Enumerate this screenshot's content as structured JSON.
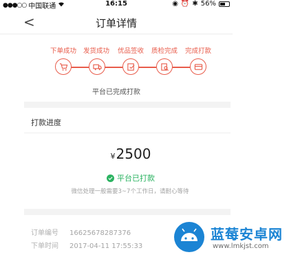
{
  "status_bar": {
    "carrier": "中国联通",
    "time": "16:15",
    "battery": "56%"
  },
  "nav": {
    "title": "订单详情",
    "back": "<"
  },
  "steps": [
    {
      "label": "下单成功",
      "icon": "cart-icon"
    },
    {
      "label": "发货成功",
      "icon": "truck-icon"
    },
    {
      "label": "优品签收",
      "icon": "sign-icon"
    },
    {
      "label": "质检完成",
      "icon": "inspect-icon"
    },
    {
      "label": "完成打款",
      "icon": "card-icon"
    }
  ],
  "order_status": "平台已完成打款",
  "payment": {
    "section_title": "打款进度",
    "currency": "¥",
    "amount": "2500",
    "paid_label": "平台已打款",
    "note": "微信处理一般需要3~7个工作日，请耐心等待"
  },
  "order_info": {
    "number_label": "订单编号",
    "number": "16625678287376",
    "time_label": "下单时间",
    "time": "2017-04-11 17:55:33"
  },
  "watermark": {
    "name": "蓝莓安卓网",
    "url": "www.lmkjst.com"
  },
  "colors": {
    "accent": "#e85b4a",
    "success": "#2bb361",
    "watermark": "#1b84d4"
  }
}
